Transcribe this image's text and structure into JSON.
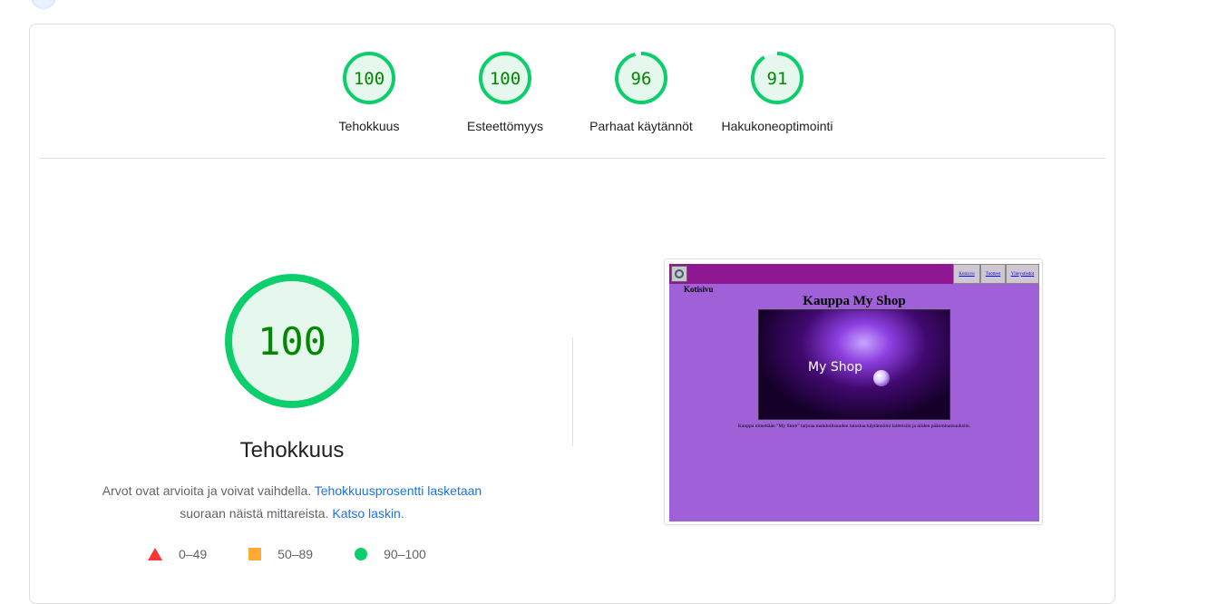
{
  "summary": {
    "categories": [
      {
        "label": "Tehokkuus",
        "score": 100,
        "color": "#0cce6b",
        "text_color": "#008800"
      },
      {
        "label": "Esteettömyys",
        "score": 100,
        "color": "#0cce6b",
        "text_color": "#008800"
      },
      {
        "label": "Parhaat käytännöt",
        "score": 96,
        "color": "#0cce6b",
        "text_color": "#008800"
      },
      {
        "label": "Hakukoneoptimointi",
        "score": 91,
        "color": "#0cce6b",
        "text_color": "#008800"
      }
    ]
  },
  "performance": {
    "score": 100,
    "title": "Tehokkuus",
    "desc_part1": "Arvot ovat arvioita ja voivat vaihdella.",
    "link1": "Tehokkuusprosentti lasketaan",
    "desc_part2": "suoraan näistä mittareista.",
    "link2": "Katso laskin."
  },
  "legend": [
    {
      "symbol": "triangle",
      "range": "0–49",
      "color": "#ff3333"
    },
    {
      "symbol": "square",
      "range": "50–89",
      "color": "#ffaa33"
    },
    {
      "symbol": "circle",
      "range": "90–100",
      "color": "#0cce6b"
    }
  ],
  "screenshot": {
    "nav_links": [
      "Kotisivu",
      "Tuotteet",
      "Yhteystiedot"
    ],
    "breadcrumb": "Kotisivu",
    "heading": "Kauppa My Shop",
    "hero_text": "My Shop",
    "paragraph": "Kauppa nimeltään \"My Store\" tarjoaa mahdollisuuden tutustua käytännöini laitteisiin ja niiden pääominaisuuksiin."
  },
  "colors": {
    "pass_green": "#0cce6b",
    "link_blue": "#1a73e8",
    "site_bg": "#a060d8",
    "site_header": "#8e1792"
  }
}
